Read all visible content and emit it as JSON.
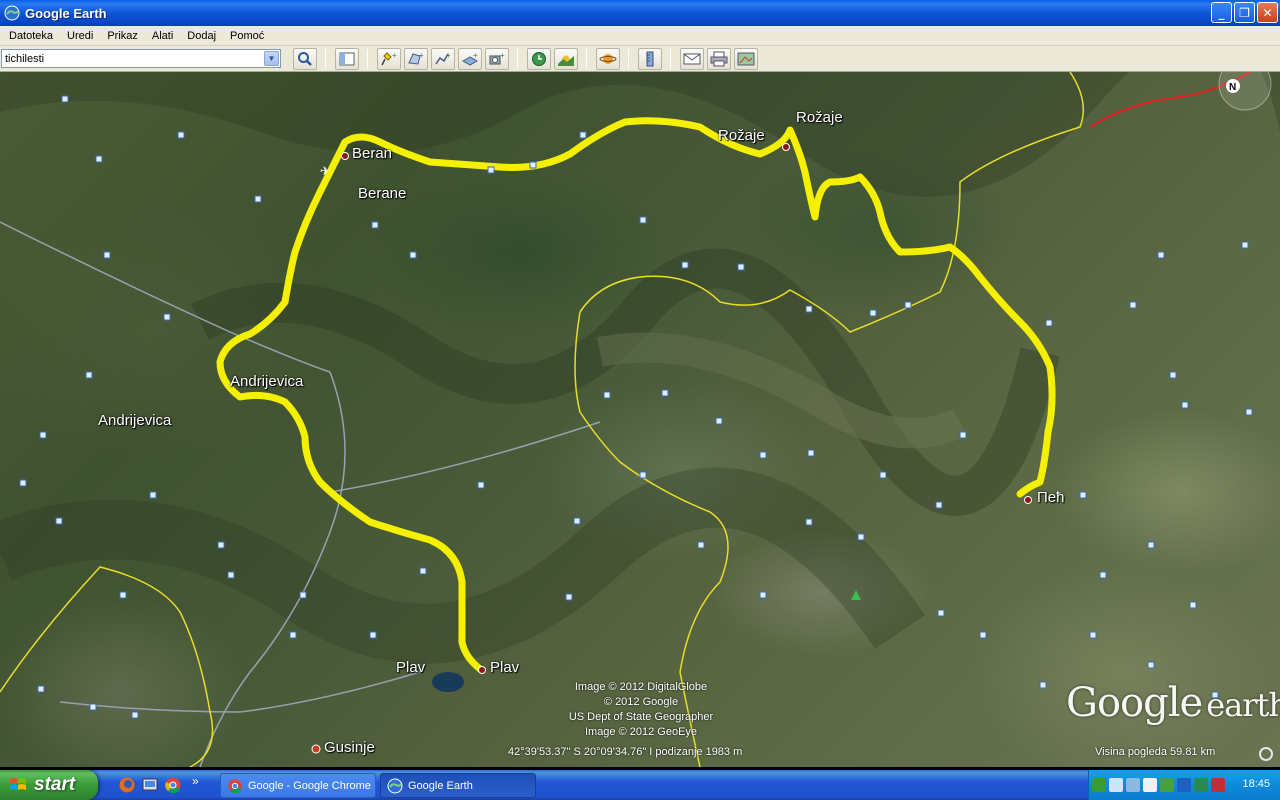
{
  "window": {
    "title": "Google Earth",
    "minimize": "_",
    "maximize": "❐",
    "close": "✕"
  },
  "menu": [
    "Datoteka",
    "Uredi",
    "Prikaz",
    "Alati",
    "Dodaj",
    "Pomoć"
  ],
  "search": {
    "value": "tichilesti"
  },
  "map": {
    "labels": {
      "berane_city": "Beran",
      "berane_region": "Berane",
      "rozaje_city": "Rožaje",
      "rozaje_region": "Rožaje",
      "andrijevica_city": "Andrijevica",
      "andrijevica_region": "Andrijevica",
      "plav_city": "Plav",
      "plav_region": "Plav",
      "pec_city": "Пећ",
      "gusinje_city": "Gusinje"
    },
    "copyright": [
      "Image © 2012 DigitalGlobe",
      "© 2012 Google",
      "US Dept of State Geographer",
      "Image © 2012 GeoEye"
    ],
    "coordinates": "42°39'53.37\" S  20°09'34.76\" I  podizanje  1983 m",
    "eye_altitude": "Visina pogleda    59.81 km",
    "logo_google": "Google",
    "logo_earth": "earth",
    "compass_letter": "N",
    "route_color": "#f4f000",
    "border_color": "#e8dd2a",
    "road_color": "#9aa0b0",
    "country_border_color": "#e02020"
  },
  "taskbar": {
    "start": "start",
    "quick_launch_more": "»",
    "tasks": [
      {
        "label": "Google - Google Chrome"
      },
      {
        "label": "Google Earth"
      }
    ],
    "clock": "18:45"
  }
}
